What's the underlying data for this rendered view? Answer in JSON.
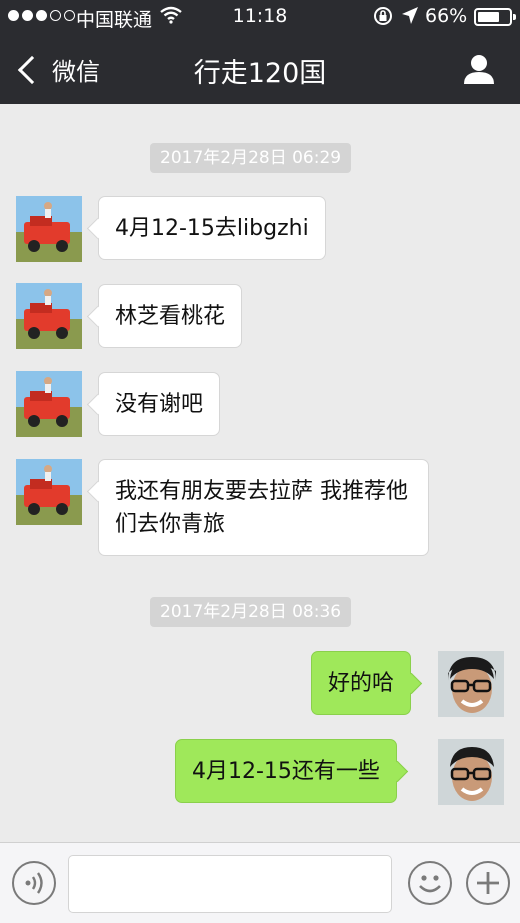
{
  "status_bar": {
    "carrier": "●●●○○ 中国联通",
    "carrier_name": "中国联通",
    "time": "11:18",
    "battery": "66%",
    "battery_level": 0.66
  },
  "nav": {
    "back_label": "微信",
    "title": "行走120国"
  },
  "chat": {
    "timestamps": [
      "2017年2月28日 06:29",
      "2017年2月28日 08:36"
    ],
    "incoming": [
      "4月12-15去libgzhi",
      "林芝看桃花",
      "没有谢吧",
      "我还有朋友要去拉萨 我推荐他们去你青旅"
    ],
    "outgoing": [
      "好的哈",
      "4月12-15还有一些"
    ]
  },
  "colors": {
    "nav_bg": "#2b2c30",
    "chat_bg": "#ebebeb",
    "outgoing_bubble": "#9fe85a",
    "incoming_bubble": "#ffffff"
  }
}
